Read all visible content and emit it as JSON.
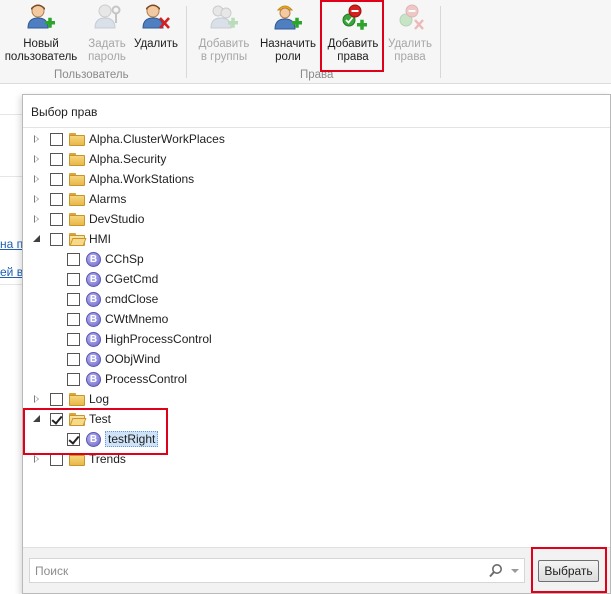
{
  "ribbon": {
    "buttons": [
      {
        "label_line1": "Новый",
        "label_line2": "пользователь",
        "icon": "user-add-icon",
        "enabled": true
      },
      {
        "label_line1": "Задать",
        "label_line2": "пароль",
        "icon": "user-key-icon",
        "enabled": false
      },
      {
        "label_line1": "Удалить",
        "label_line2": "",
        "icon": "user-delete-icon",
        "enabled": true
      },
      {
        "label_line1": "Добавить",
        "label_line2": "в группы",
        "icon": "group-add-icon",
        "enabled": false
      },
      {
        "label_line1": "Назначить",
        "label_line2": "роли",
        "icon": "worker-add-icon",
        "enabled": true
      },
      {
        "label_line1": "Добавить",
        "label_line2": "права",
        "icon": "rights-add-icon",
        "enabled": true
      },
      {
        "label_line1": "Удалить",
        "label_line2": "права",
        "icon": "rights-delete-icon",
        "enabled": false
      }
    ],
    "groups": {
      "user": "Пользователь",
      "rights": "Права"
    }
  },
  "background": {
    "link1": "на па",
    "link2": "ей в"
  },
  "dialog": {
    "title": "Выбор прав",
    "tree": [
      {
        "label": "Alpha.ClusterWorkPlaces",
        "type": "folder",
        "level": 0,
        "state": "collapsed",
        "checked": false
      },
      {
        "label": "Alpha.Security",
        "type": "folder",
        "level": 0,
        "state": "collapsed",
        "checked": false
      },
      {
        "label": "Alpha.WorkStations",
        "type": "folder",
        "level": 0,
        "state": "collapsed",
        "checked": false
      },
      {
        "label": "Alarms",
        "type": "folder",
        "level": 0,
        "state": "collapsed",
        "checked": false
      },
      {
        "label": "DevStudio",
        "type": "folder",
        "level": 0,
        "state": "collapsed",
        "checked": false
      },
      {
        "label": "HMI",
        "type": "folder",
        "level": 0,
        "state": "expanded",
        "checked": false
      },
      {
        "label": "CChSp",
        "type": "right",
        "level": 1,
        "checked": false
      },
      {
        "label": "CGetCmd",
        "type": "right",
        "level": 1,
        "checked": false
      },
      {
        "label": "cmdClose",
        "type": "right",
        "level": 1,
        "checked": false
      },
      {
        "label": "CWtMnemo",
        "type": "right",
        "level": 1,
        "checked": false
      },
      {
        "label": "HighProcessControl",
        "type": "right",
        "level": 1,
        "checked": false
      },
      {
        "label": "OObjWind",
        "type": "right",
        "level": 1,
        "checked": false
      },
      {
        "label": "ProcessControl",
        "type": "right",
        "level": 1,
        "checked": false
      },
      {
        "label": "Log",
        "type": "folder",
        "level": 0,
        "state": "collapsed",
        "checked": false
      },
      {
        "label": "Test",
        "type": "folder",
        "level": 0,
        "state": "expanded",
        "checked": true
      },
      {
        "label": "testRight",
        "type": "right",
        "level": 1,
        "checked": true,
        "selected": true
      },
      {
        "label": "Trends",
        "type": "folder",
        "level": 0,
        "state": "collapsed",
        "checked": false
      }
    ],
    "right_badge_letter": "B",
    "search_placeholder": "Поиск",
    "select_button": "Выбрать"
  },
  "colors": {
    "highlight": "#e1001a",
    "link": "#1f5fb4",
    "selection": "#cfe3f8"
  }
}
